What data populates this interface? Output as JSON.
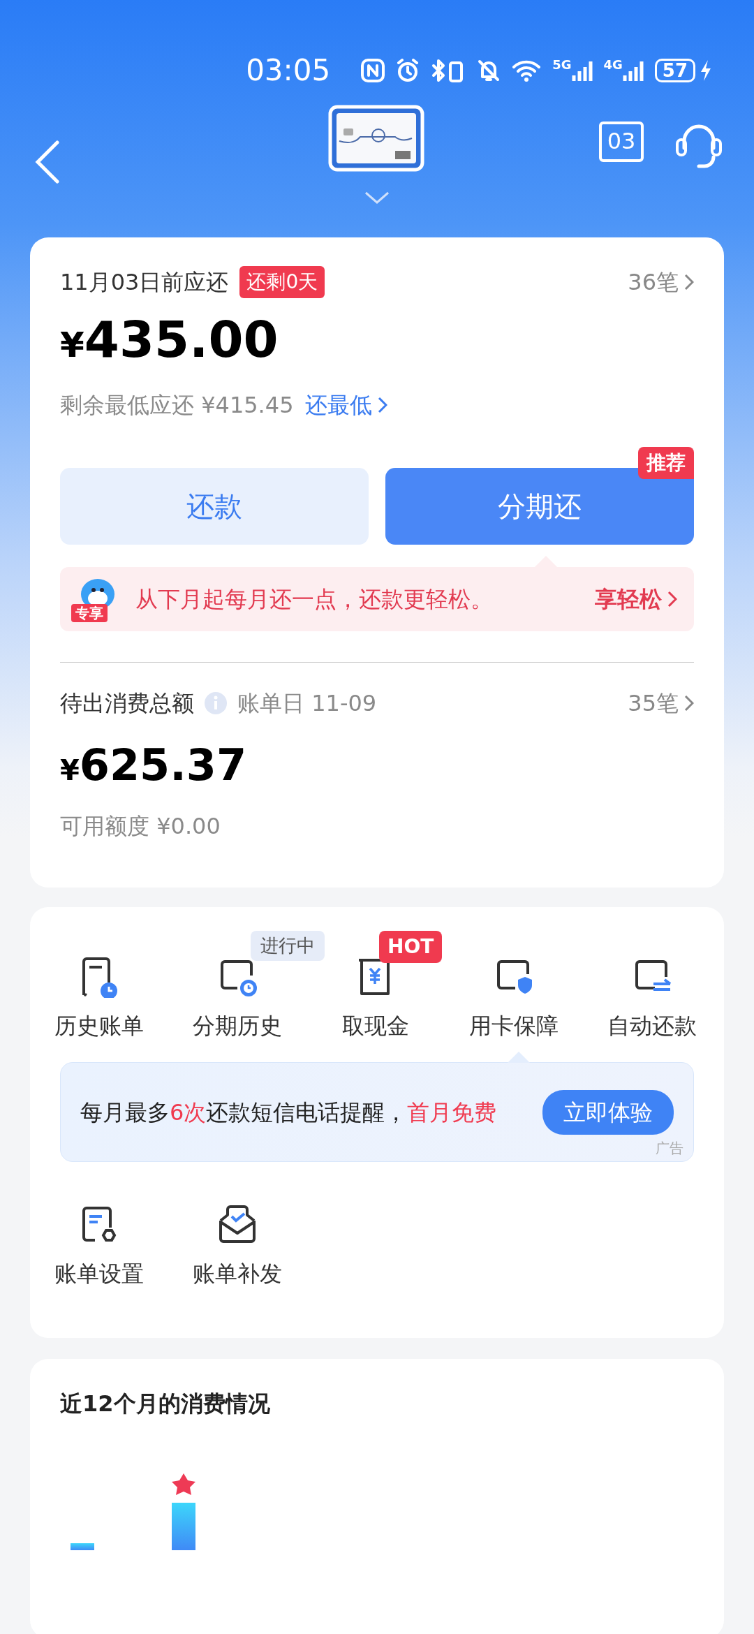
{
  "status_bar": {
    "time": "03:05",
    "networks": [
      "5G",
      "4G"
    ],
    "battery": "57"
  },
  "header": {
    "calendar_day": "03"
  },
  "bill": {
    "due_label": "11月03日前应还",
    "countdown_badge": "还剩0天",
    "count_link": "36笔",
    "currency": "¥",
    "amount": "435.00",
    "minimum": "剩余最低应还 ¥415.45",
    "minimum_link": "还最低"
  },
  "actions": [
    {
      "label": "还款",
      "kind": "secondary"
    },
    {
      "label": "分期还",
      "kind": "primary",
      "badge": "推荐"
    }
  ],
  "promo": {
    "badge": "专享",
    "text": "从下月起每月还一点，还款更轻松。",
    "link": "享轻松"
  },
  "pending": {
    "label": "待出消费总额",
    "bill_date": "账单日 11-09",
    "count_link": "35笔",
    "currency": "¥",
    "amount": "625.37",
    "credit": "可用额度 ¥0.00"
  },
  "services": [
    {
      "label": "历史账单"
    },
    {
      "label": "分期历史",
      "tag": {
        "text": "进行中",
        "kind": "status"
      }
    },
    {
      "label": "取现金",
      "tag": {
        "text": "HOT",
        "kind": "hot"
      }
    },
    {
      "label": "用卡保障"
    },
    {
      "label": "自动还款"
    }
  ],
  "ad": {
    "segments": [
      {
        "text": "每月最多",
        "highlight": false
      },
      {
        "text": "6次",
        "highlight": true
      },
      {
        "text": "还款短信电话提醒，",
        "highlight": false
      },
      {
        "text": "首月免费",
        "highlight": true
      }
    ],
    "button": "立即体验",
    "label": "广告"
  },
  "services_more": [
    {
      "label": "账单设置"
    },
    {
      "label": "账单补发"
    }
  ],
  "spending": {
    "title": "近12个月的消费情况"
  }
}
